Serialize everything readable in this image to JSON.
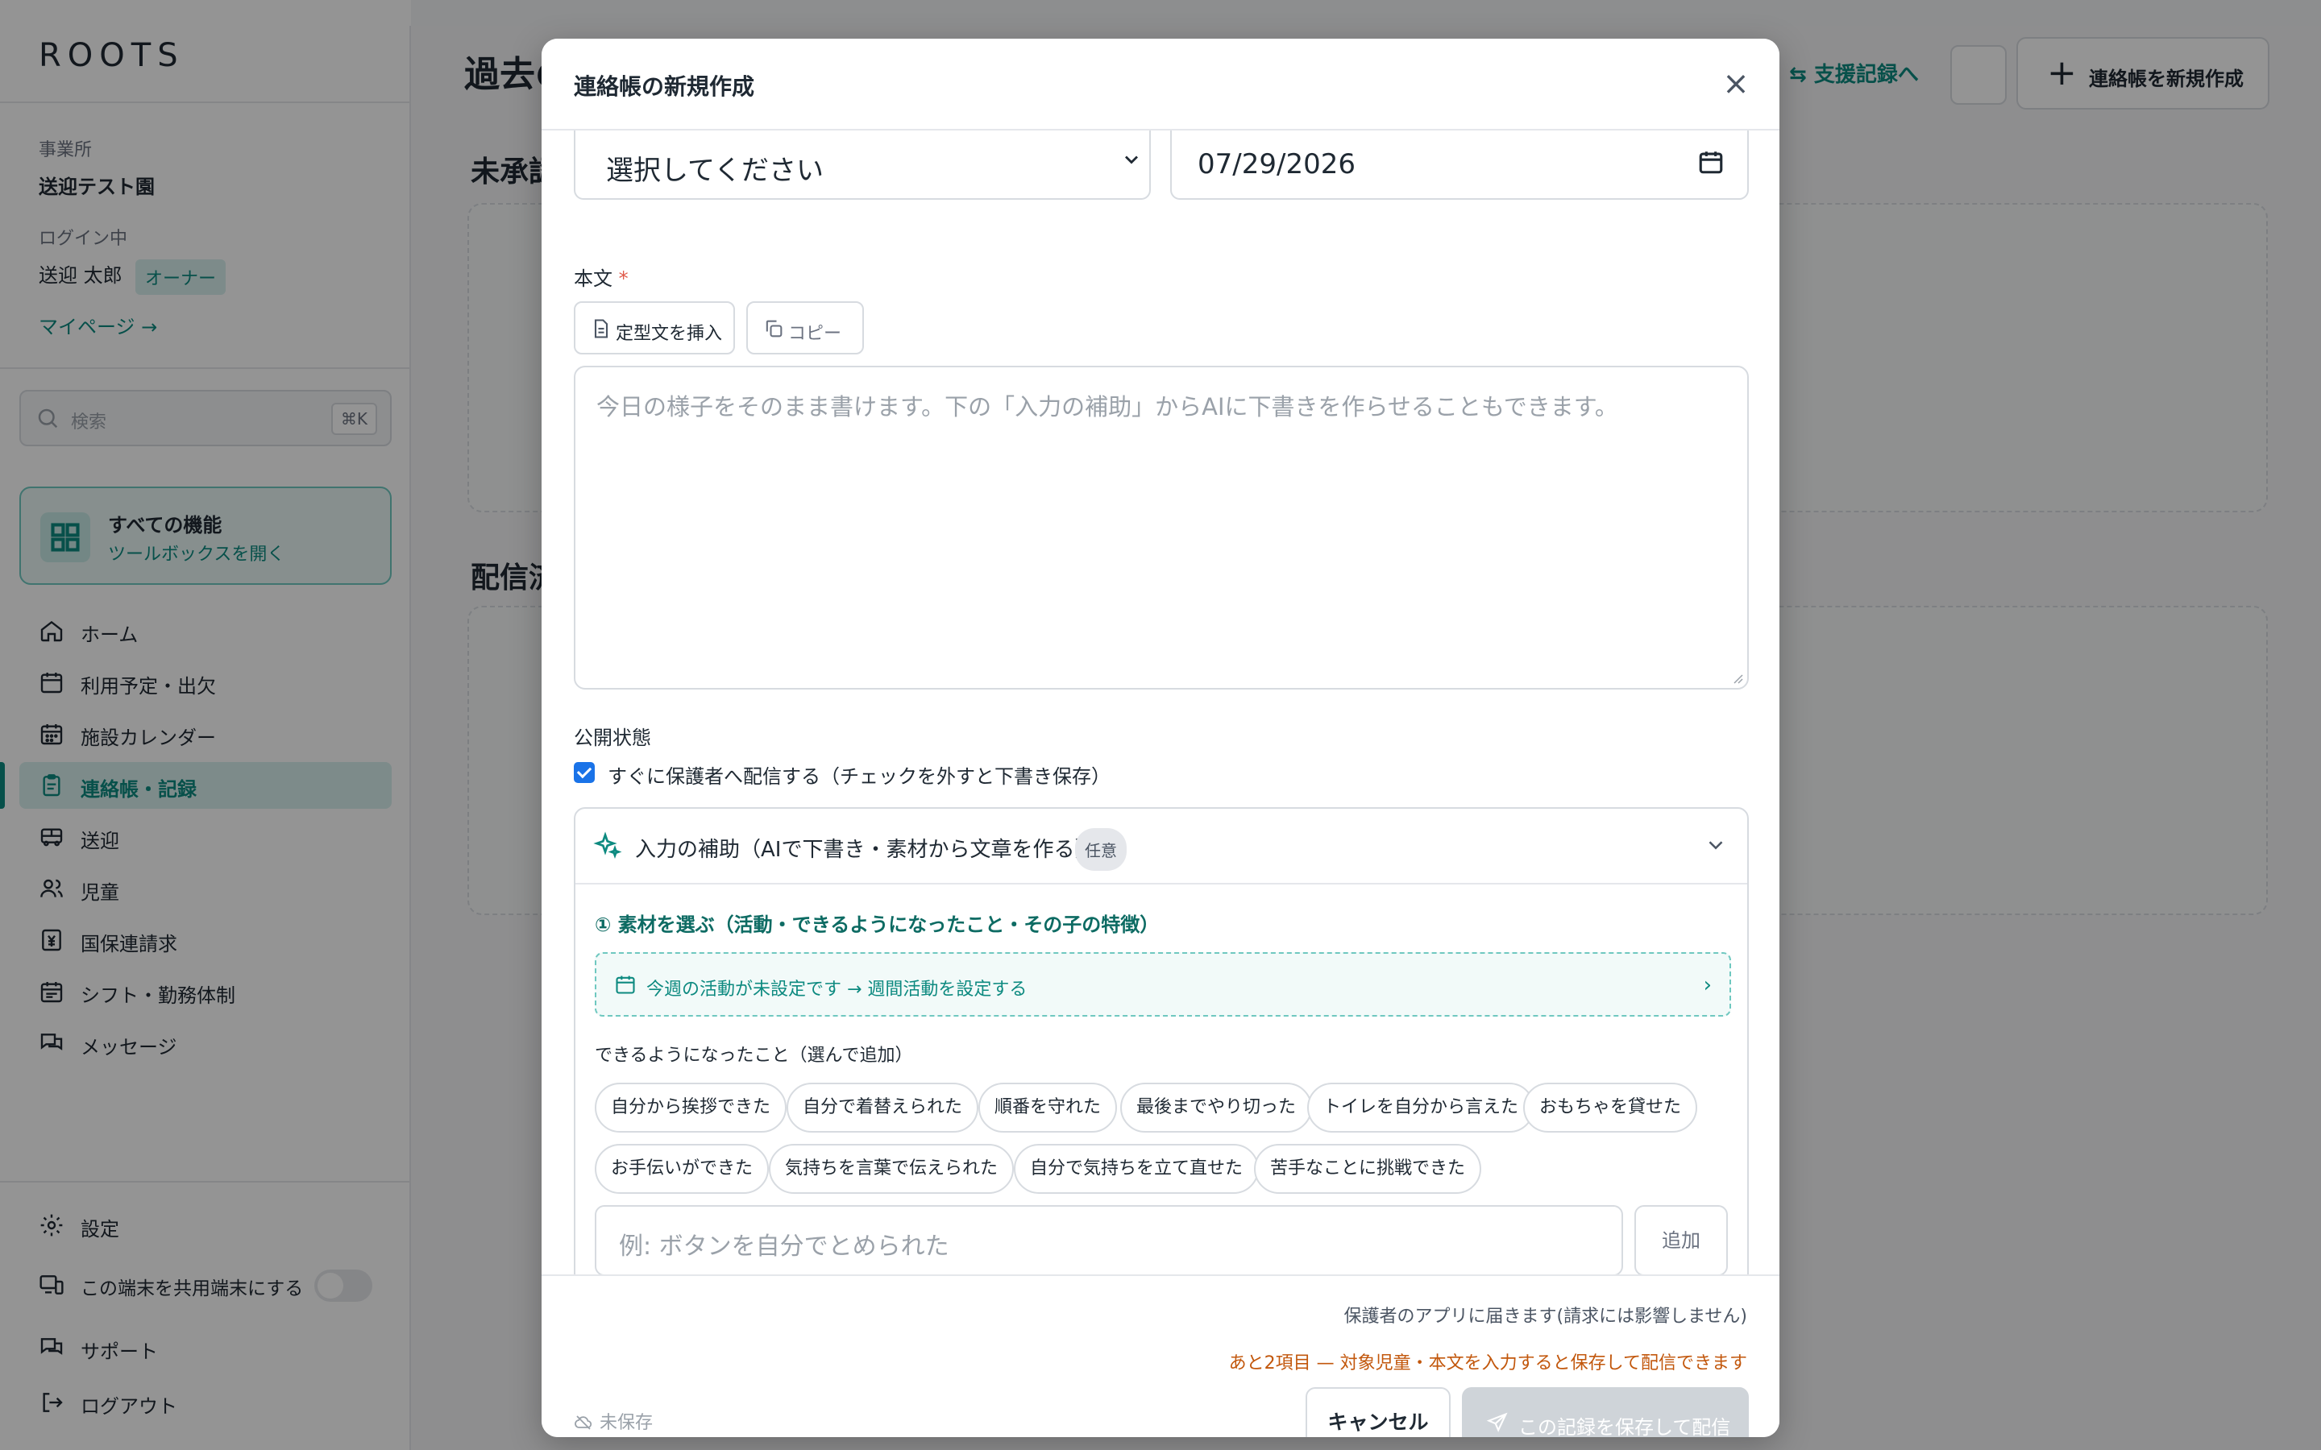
{
  "app": {
    "logo": "ROOTS",
    "office_label": "事業所",
    "office_name": "送迎テスト園",
    "login_label": "ログイン中",
    "user_name": "送迎 太郎",
    "role_badge": "オーナー",
    "mypage_link": "マイページ →",
    "search_placeholder": "検索",
    "search_shortcut": "⌘K",
    "all_features_title": "すべての機能",
    "all_features_sub": "ツールボックスを開く",
    "nav": [
      {
        "label": "ホーム",
        "icon": "home-icon"
      },
      {
        "label": "利用予定・出欠",
        "icon": "calendar-icon"
      },
      {
        "label": "施設カレンダー",
        "icon": "calendar-grid-icon"
      },
      {
        "label": "連絡帳・記録",
        "icon": "clipboard-icon",
        "active": true
      },
      {
        "label": "送迎",
        "icon": "bus-icon"
      },
      {
        "label": "児童",
        "icon": "users-icon"
      },
      {
        "label": "国保連請求",
        "icon": "billing-icon"
      },
      {
        "label": "シフト・勤務体制",
        "icon": "shift-calendar-icon"
      },
      {
        "label": "メッセージ",
        "icon": "messages-icon"
      }
    ],
    "bottom_nav": {
      "settings": "設定",
      "shared_device": "この端末を共用端末にする",
      "support": "サポート",
      "logout": "ログアウト"
    },
    "page_title": "過去の",
    "section_unapproved": "未承認",
    "section_delivered": "配信済",
    "header_link": "⇆ 支援記録へ",
    "header_new_button": "連絡帳を新規作成",
    "accent_color": "#0d8a80"
  },
  "modal": {
    "title": "連絡帳の新規作成",
    "child_select_value": "選択してください",
    "date_value": "07/29/2026",
    "body_label": "本文",
    "required_mark": "*",
    "insert_template_button": "定型文を挿入",
    "copy_button": "コピー",
    "body_placeholder": "今日の様子をそのまま書けます。下の「入力の補助」からAIに下書きを作らせることもできます。",
    "visibility_label": "公開状態",
    "publish_checkbox_label": "すぐに保護者へ配信する（チェックを外すと下書き保存）",
    "publish_checked": true,
    "assist": {
      "title": "入力の補助（AIで下書き・素材から文章を作る）",
      "optional_badge": "任意",
      "step1_title": "① 素材を選ぶ（活動・できるようになったこと・その子の特徴）",
      "weekly_link": "今週の活動が未設定です → 週間活動を設定する",
      "achievements_label": "できるようになったこと（選んで追加）",
      "chips_row1": [
        "自分から挨拶できた",
        "自分で着替えられた",
        "順番を守れた",
        "最後までやり切った",
        "トイレを自分から言えた",
        "おもちゃを貸せた"
      ],
      "chips_row2": [
        "お手伝いができた",
        "気持ちを言葉で伝えられた",
        "自分で気持ちを立て直せた",
        "苦手なことに挑戦できた"
      ],
      "add_placeholder": "例: ボタンを自分でとめられた",
      "add_button": "追加"
    },
    "footer": {
      "note": "保護者のアプリに届きます(請求には影響しません)",
      "warning": "あと2項目 — 対象児童・本文を入力すると保存して配信できます",
      "unsaved": "未保存",
      "cancel_button": "キャンセル",
      "save_button": "この記録を保存して配信"
    }
  }
}
